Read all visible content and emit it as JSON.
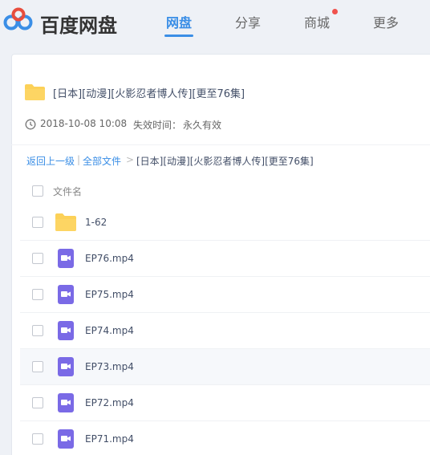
{
  "brand": {
    "name": "百度网盘"
  },
  "nav": {
    "items": [
      {
        "label": "网盘",
        "active": true
      },
      {
        "label": "分享",
        "active": false
      },
      {
        "label": "商城",
        "active": false,
        "badge_dot": true
      },
      {
        "label": "更多",
        "active": false
      }
    ]
  },
  "share": {
    "title": "[日本][动漫][火影忍者博人传][更至76集]",
    "date": "2018-10-08 10:08",
    "expire_label": "失效时间：",
    "expire_value": "永久有效"
  },
  "breadcrumb": {
    "back": "返回上一级",
    "separator": "|",
    "all_files": "全部文件",
    "arrow": ">",
    "current": "[日本][动漫][火影忍者博人传][更至76集]"
  },
  "file_list": {
    "header": "文件名",
    "rows": [
      {
        "name": "1-62",
        "icon": "folder-icon"
      },
      {
        "name": "EP76.mp4",
        "icon": "video-file-icon"
      },
      {
        "name": "EP75.mp4",
        "icon": "video-file-icon"
      },
      {
        "name": "EP74.mp4",
        "icon": "video-file-icon"
      },
      {
        "name": "EP73.mp4",
        "icon": "video-file-icon"
      },
      {
        "name": "EP72.mp4",
        "icon": "video-file-icon"
      },
      {
        "name": "EP71.mp4",
        "icon": "video-file-icon"
      }
    ]
  },
  "colors": {
    "accent": "#3a8ee6",
    "folder": "#fcd158",
    "video_icon": "#7a6ae6",
    "badge": "#f0524d"
  }
}
